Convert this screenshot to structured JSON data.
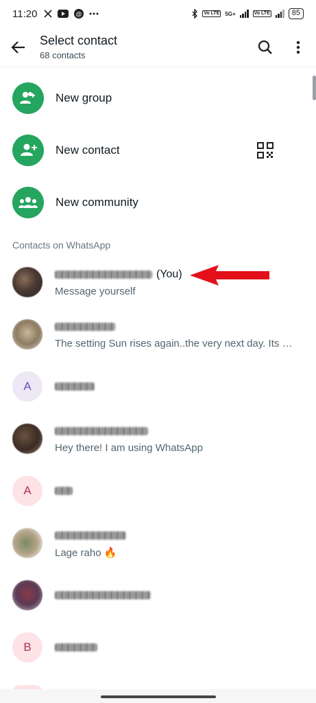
{
  "status_bar": {
    "time": "11:20",
    "left_icons": [
      "x-icon",
      "youtube-icon",
      "threads-icon",
      "more-dots"
    ],
    "network_label": "5G+",
    "vo_label": "Vo LTE",
    "battery": "85"
  },
  "app_bar": {
    "title": "Select contact",
    "subtitle": "68 contacts"
  },
  "actions": [
    {
      "label": "New group",
      "icon": "group-add-icon"
    },
    {
      "label": "New contact",
      "icon": "person-add-icon"
    },
    {
      "label": "New community",
      "icon": "community-icon"
    }
  ],
  "section_header": "Contacts on WhatsApp",
  "contacts": [
    {
      "avatar": "photo",
      "you_tag": "(You)",
      "status": "Message yourself"
    },
    {
      "avatar": "photo",
      "status": "The setting Sun rises again..the very next day. Its ur..."
    },
    {
      "avatar": "letter",
      "letter": "A",
      "status": ""
    },
    {
      "avatar": "photo",
      "status": "Hey there! I am using WhatsApp"
    },
    {
      "avatar": "letter",
      "letter": "A",
      "status": ""
    },
    {
      "avatar": "photo",
      "status": "Lage raho 🔥"
    },
    {
      "avatar": "photo",
      "status": ""
    },
    {
      "avatar": "letter",
      "letter": "B",
      "status": ""
    }
  ],
  "colors": {
    "accent_green": "#25a55f",
    "annotation_red": "#e3101a"
  }
}
